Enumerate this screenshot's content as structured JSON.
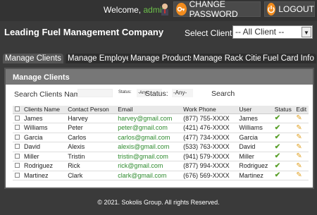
{
  "header": {
    "welcome_prefix": "Welcome,",
    "username": "admin",
    "change_password_label": "CHANGE PASSWORD",
    "logout_label": "LOGOUT"
  },
  "company": "Leading Fuel Management Company",
  "client_selector": {
    "label": "Select Client :",
    "value": "-- All Client --"
  },
  "tabs": [
    {
      "label": "Manage Clients"
    },
    {
      "label": "Manage Employees"
    },
    {
      "label": "Manage Products"
    },
    {
      "label": "Manage Rack Cities"
    },
    {
      "label": "Fuel Card Info"
    }
  ],
  "panel": {
    "title": "Manage Clients",
    "search_label": "Search Clients Name:",
    "status_label_small": "Status:",
    "status_small_value": "-Any-",
    "status_label": "Status:",
    "status_value": "-Any-",
    "search_button": "Search"
  },
  "table": {
    "headers": {
      "client": "Clients Name",
      "contact": "Contact Person",
      "email": "Email",
      "phone": "Work Phone",
      "user": "User",
      "status": "Status",
      "edit": "Edit"
    },
    "rows": [
      {
        "client": "James",
        "contact": "Harvey",
        "email": "harvey@gmail.com",
        "phone": "(877) 755-XXXX",
        "user": "James"
      },
      {
        "client": "Williams",
        "contact": "Peter",
        "email": "peter@gmail.com",
        "phone": "(421) 476-XXXX",
        "user": "Williams"
      },
      {
        "client": "Garcia",
        "contact": "Carlos",
        "email": "carlos@gmail.com",
        "phone": "(477) 734-XXXX",
        "user": "Garcia"
      },
      {
        "client": "David",
        "contact": "Alexis",
        "email": "alexis@gmail.com",
        "phone": "(533) 763-XXXX",
        "user": "David"
      },
      {
        "client": "Miller",
        "contact": "Tristin",
        "email": "tristin@gmail.com",
        "phone": "(941) 579-XXXX",
        "user": "Miller"
      },
      {
        "client": "Rodriguez",
        "contact": "Rick",
        "email": "rick@gmail.com",
        "phone": "(877) 994-XXXX",
        "user": "Rodriguez"
      },
      {
        "client": "Martinez",
        "contact": "Clark",
        "email": "clark@gmail.com",
        "phone": "(676) 569-XXXX",
        "user": "Martinez"
      }
    ]
  },
  "footer": "© 2021. Sokolis Group. All rights Reserved.",
  "colors": {
    "accent": "#f28c1e",
    "email": "#2e8b2e",
    "status_tick": "#5aa02c",
    "username": "#6cc04a"
  }
}
